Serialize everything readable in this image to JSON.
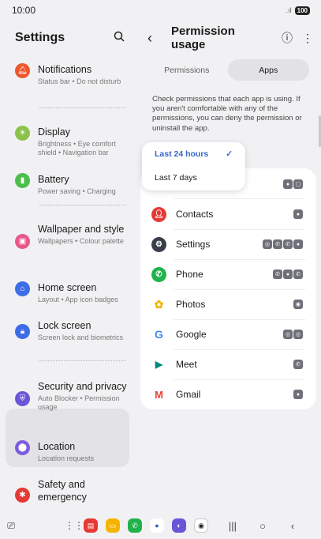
{
  "status": {
    "time": "10:00",
    "battery": "100",
    "signal": "signal-icon"
  },
  "colors": {
    "accent": "#3366c7",
    "selected_bg": "#e3e3e6"
  },
  "left": {
    "title": "Settings",
    "search_icon": "search-icon",
    "items": [
      {
        "title": "Notifications",
        "sub": "Status bar  •  Do not disturb",
        "icon": "bell-icon",
        "color": "#f0562d"
      },
      {
        "title": "Display",
        "sub": "Brightness  •  Eye comfort shield  •  Navigation bar",
        "icon": "sun-icon",
        "color": "#8bc34a"
      },
      {
        "title": "Battery",
        "sub": "Power saving  •  Charging",
        "icon": "battery-icon",
        "color": "#4bbf4b"
      },
      {
        "title": "Wallpaper and style",
        "sub": "Wallpapers  •  Colour palette",
        "icon": "image-icon",
        "color": "#e8588a"
      },
      {
        "title": "Home screen",
        "sub": "Layout  •  App icon badges",
        "icon": "home-icon",
        "color": "#3d6ce8"
      },
      {
        "title": "Lock screen",
        "sub": "Screen lock and biometrics",
        "icon": "lock-icon",
        "color": "#3d6ce8"
      },
      {
        "title": "Security and privacy",
        "sub": "Auto Blocker  •  Permission usage",
        "icon": "shield-icon",
        "color": "#6a55d8"
      },
      {
        "title": "Location",
        "sub": "Location requests",
        "icon": "location-icon",
        "color": "#7c5ce0"
      },
      {
        "title": "Safety and emergency",
        "sub": "",
        "icon": "emergency-icon",
        "color": "#e53935"
      }
    ]
  },
  "right": {
    "title": "Permission usage",
    "tabs": [
      "Permissions",
      "Apps"
    ],
    "description": "Check permissions that each app is using. If you aren't comfortable with any of the permissions, you can deny the permission or uninstall the app.",
    "dropdown": [
      "Last 24 hours",
      "Last 7 days"
    ],
    "apps": [
      {
        "name": "",
        "perms": 2
      },
      {
        "name": "Contacts",
        "perms": 1,
        "color": "#e53935"
      },
      {
        "name": "Settings",
        "perms": 4,
        "color": "#3a3d4a"
      },
      {
        "name": "Phone",
        "perms": 3,
        "color": "#20b24b"
      },
      {
        "name": "Photos",
        "perms": 1,
        "color": "#f4b400"
      },
      {
        "name": "Google",
        "perms": 2,
        "color": "#4285f4"
      },
      {
        "name": "Meet",
        "perms": 1,
        "color": "#00897b"
      },
      {
        "name": "Gmail",
        "perms": 1,
        "color": "#ea4335"
      }
    ]
  }
}
